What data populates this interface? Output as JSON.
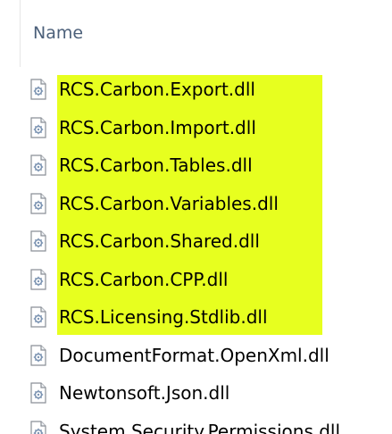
{
  "header": {
    "name_label": "Name"
  },
  "files": [
    {
      "name": "RCS.Carbon.Export.dll",
      "icon": "dll-file-icon",
      "highlighted": true
    },
    {
      "name": "RCS.Carbon.Import.dll",
      "icon": "dll-file-icon",
      "highlighted": true
    },
    {
      "name": "RCS.Carbon.Tables.dll",
      "icon": "dll-file-icon",
      "highlighted": true
    },
    {
      "name": "RCS.Carbon.Variables.dll",
      "icon": "dll-file-icon",
      "highlighted": true
    },
    {
      "name": "RCS.Carbon.Shared.dll",
      "icon": "dll-file-icon",
      "highlighted": true
    },
    {
      "name": "RCS.Carbon.CPP.dll",
      "icon": "dll-file-icon",
      "highlighted": true
    },
    {
      "name": "RCS.Licensing.Stdlib.dll",
      "icon": "dll-file-icon",
      "highlighted": true
    },
    {
      "name": "DocumentFormat.OpenXml.dll",
      "icon": "dll-file-icon",
      "highlighted": false
    },
    {
      "name": "Newtonsoft.Json.dll",
      "icon": "dll-file-icon",
      "highlighted": false
    },
    {
      "name": "System.Security.Permissions.dll",
      "icon": "dll-file-icon",
      "highlighted": false
    }
  ],
  "colors": {
    "highlight": "#e7ff1f",
    "header_text": "#4c607a"
  }
}
